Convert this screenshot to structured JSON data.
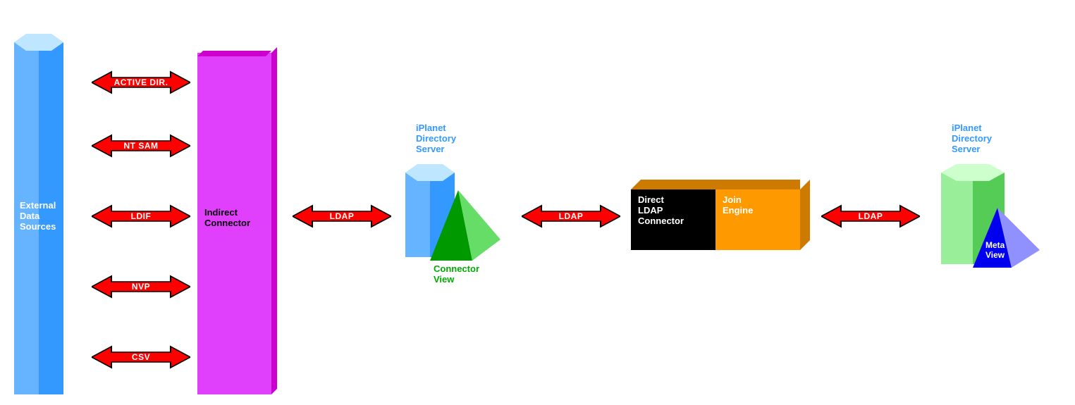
{
  "nodes": {
    "external": {
      "label": "External\nData\nSources"
    },
    "indirect": {
      "label": "Indirect\nConnector"
    },
    "ids1": {
      "label": "iPlanet\nDirectory\nServer"
    },
    "connview": {
      "label": "Connector\nView"
    },
    "directconn": {
      "label": "Direct\nLDAP\nConnector"
    },
    "joinengine": {
      "label": "Join\nEngine"
    },
    "ids2": {
      "label": "iPlanet\nDirectory\nServer"
    },
    "metaview": {
      "label": "Meta\nView"
    }
  },
  "arrows": {
    "activedir": "ACTIVE DIR.",
    "ntsam": "NT SAM",
    "ldif": "LDIF",
    "nvp": "NVP",
    "csv": "CSV",
    "ldap1": "LDAP",
    "ldap2": "LDAP",
    "ldap3": "LDAP"
  },
  "colors": {
    "arrow_fill": "#ff0000",
    "arrow_stroke": "#000000",
    "ext_light": "#bfe6ff",
    "ext_mid": "#66b3ff",
    "ext_dark": "#3399ff",
    "indirect_light": "#f0a0ff",
    "indirect_mid": "#e040fb",
    "indirect_dark": "#cc00cc",
    "ids1_light": "#bfe6ff",
    "ids1_mid": "#66b3ff",
    "ids1_dark": "#3399ff",
    "cv_light": "#66dd66",
    "cv_dark": "#009900",
    "box_black": "#000000",
    "box_orange": "#ff9900",
    "box_orange_dark": "#cc7a00",
    "ids2_light": "#ccffcc",
    "ids2_mid": "#99ee99",
    "ids2_dark": "#55cc55",
    "mv_light": "#9090ff",
    "mv_dark": "#0000ee"
  }
}
